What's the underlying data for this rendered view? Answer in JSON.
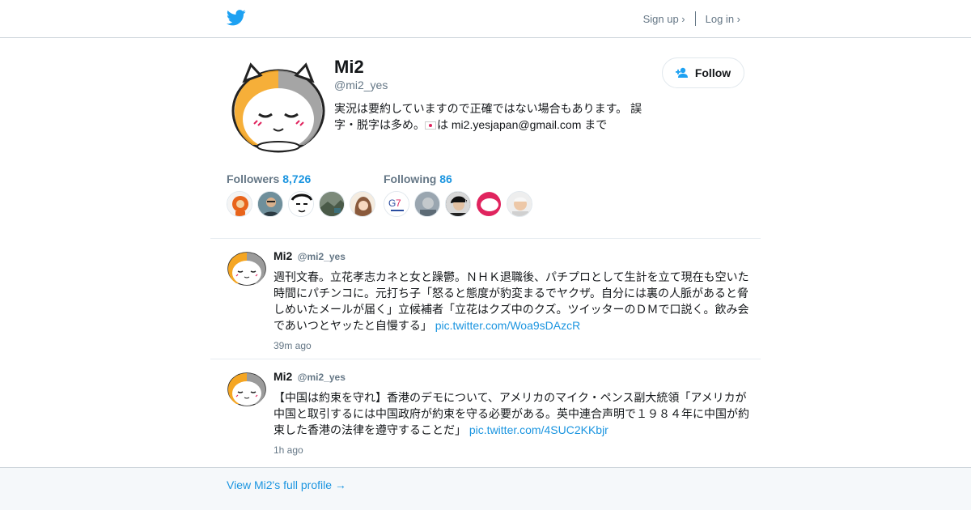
{
  "nav": {
    "signup": "Sign up ›",
    "login": "Log in ›"
  },
  "profile": {
    "name": "Mi2",
    "handle": "@mi2_yes",
    "bio_part1": "実況は要約していますので正確ではない場合もあります。 誤字・脱字は多め。",
    "bio_part2": "は mi2.yesjapan@gmail.com まで",
    "follow_label": "Follow"
  },
  "stats": {
    "followers_label": "Followers",
    "followers_count": "8,726",
    "following_label": "Following",
    "following_count": "86"
  },
  "tweets": [
    {
      "name": "Mi2",
      "handle": "@mi2_yes",
      "text": "週刊文春。立花孝志カネと女と躁鬱。ＮＨＫ退職後、パチプロとして生計を立て現在も空いた時間にパチンコに。元打ち子「怒ると態度が豹変まるでヤクザ。自分には裏の人脈があると脅しめいたメールが届く」立候補者「立花はクズ中のクズ。ツイッターのＤＭで口説く。飲み会であいつとヤッたと自慢する」",
      "link": "pic.twitter.com/Woa9sDAzcR",
      "time": "39m ago"
    },
    {
      "name": "Mi2",
      "handle": "@mi2_yes",
      "text": "【中国は約束を守れ】香港のデモについて、アメリカのマイク・ペンス副大統領「アメリカが中国と取引するには中国政府が約束を守る必要がある。英中連合声明で１９８４年に中国が約束した香港の法律を遵守することだ」",
      "link": "pic.twitter.com/4SUC2KKbjr",
      "time": "1h ago"
    }
  ],
  "footer": {
    "link": "View Mi2's full profile →"
  },
  "colors": {
    "accent": "#1b95e0",
    "secondary": "#657786",
    "footer_bg": "#f5f8fa"
  }
}
